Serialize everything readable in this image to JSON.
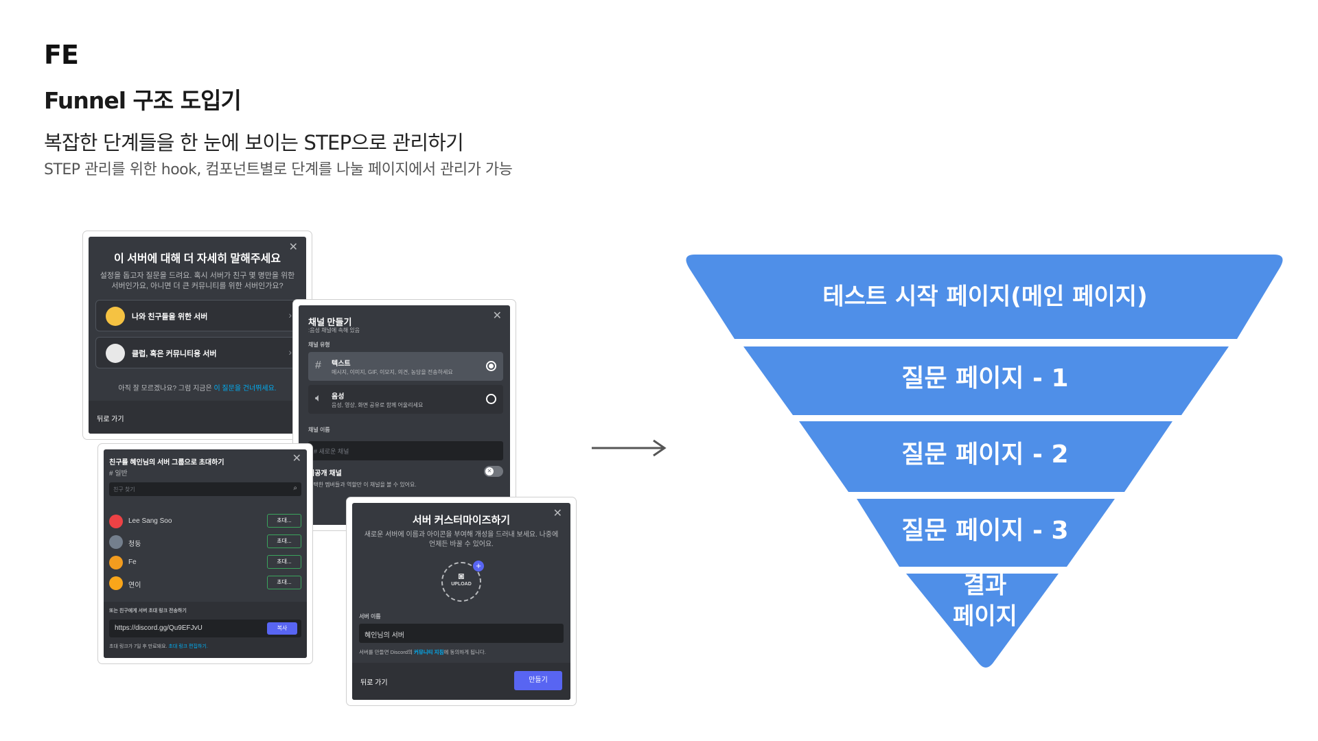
{
  "header": {
    "section": "FE",
    "title": "Funnel 구조 도입기",
    "subtitle": "복잡한 단계들을 한 눈에 보이는 STEP으로 관리하기",
    "description": "STEP 관리를 위한 hook, 컴포넌트별로 단계를 나눌 페이지에서 관리가 가능"
  },
  "screenshots": {
    "server_type": {
      "title": "이 서버에 대해 더 자세히 말해주세요",
      "description": "설정을 돕고자 질문을 드려요. 혹시 서버가 친구 몇 명만을 위한 서버인가요, 아니면 더 큰 커뮤니티를 위한 서버인가요?",
      "options": [
        "나와 친구들을 위한 서버",
        "클럽, 혹은 커뮤니티용 서버"
      ],
      "skip_prefix": "아직 잘 모르겠나요? 그럼 지금은 ",
      "skip_link": "이 질문을 건너뛰세요.",
      "back": "뒤로 가기"
    },
    "create_channel": {
      "title": "채널 만들기",
      "subtitle": ":음성 채널에 속해 있음",
      "type_label": "채널 유형",
      "channel_types": [
        {
          "name": "텍스트",
          "desc": "메시지, 이미지, GIF, 이모지, 의견, 농담을 전송하세요",
          "selected": true
        },
        {
          "name": "음성",
          "desc": "음성, 영상, 화면 공유로 함께 어울리세요",
          "selected": false
        }
      ],
      "name_label": "채널 이름",
      "name_placeholder": "# 새로운 채널",
      "private_label": "비공개 채널",
      "private_desc": "선택한 멤버들과 역할만 이 채널을 볼 수 있어요."
    },
    "invite": {
      "title": "친구를 혜인님의 서버 그룹으로 초대하기",
      "channel": "# 일반",
      "search_placeholder": "친구 찾기",
      "friends": [
        {
          "name": "Lee Sang Soo",
          "color": "#ed4245"
        },
        {
          "name": "청둥",
          "color": "#747f8d"
        },
        {
          "name": "Fe",
          "color": "#f29c1f"
        },
        {
          "name": "연이",
          "color": "#faa61a"
        }
      ],
      "invite_label": "초대...",
      "link_label": "또는 친구에게 서버 초대 링크 전송하기",
      "link": "https://discord.gg/Qu9EFJvU",
      "copy": "복사",
      "expire_prefix": "초대 링크가 7일 후 만료돼요. ",
      "expire_link": "초대 링크 편집하기."
    },
    "customize": {
      "title": "서버 커스터마이즈하기",
      "description": "새로운 서버에 이름과 아이콘을 부여해 개성을 드러내 보세요. 나중에 언제든 바꿀 수 있어요.",
      "upload": "UPLOAD",
      "name_label": "서버 이름",
      "name_value": "혜인님의 서버",
      "terms_prefix": "서버를 만들면 Discord의 ",
      "terms_link": "커뮤니티 지침",
      "terms_suffix": "에 동의하게 됩니다.",
      "back": "뒤로 가기",
      "create": "만들기"
    }
  },
  "funnel": {
    "color": "#4f8fe8",
    "stages": [
      "테스트 시작 페이지(메인 페이지)",
      "질문 페이지 - 1",
      "질문 페이지 - 2",
      "질문 페이지 - 3",
      "결과",
      "페이지"
    ]
  }
}
